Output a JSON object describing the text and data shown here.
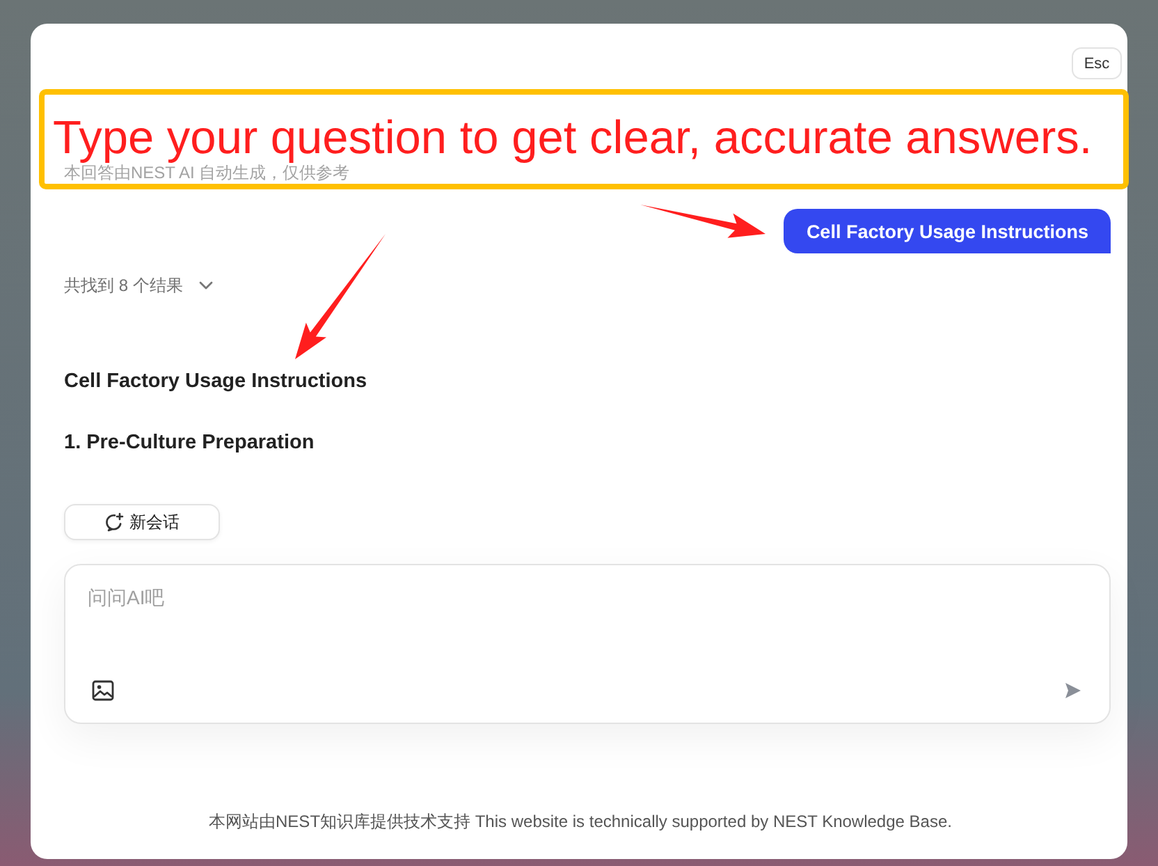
{
  "dialog": {
    "close_key": "Esc"
  },
  "annotation": {
    "callout": "Type your question to get clear, accurate answers."
  },
  "answer": {
    "disclaimer": "本回答由NEST AI 自动生成，仅供参考",
    "user_message": "Cell Factory Usage Instructions",
    "results_summary": "共找到 8 个结果",
    "results_expanded": false,
    "heading": "Cell Factory Usage Instructions",
    "sections": [
      "1. Pre-Culture Preparation"
    ]
  },
  "new_chat_button": "新会话",
  "composer": {
    "placeholder": "问问AI吧"
  },
  "footer": "本网站由NEST知识库提供技术支持 This website is technically supported by NEST Knowledge Base."
}
